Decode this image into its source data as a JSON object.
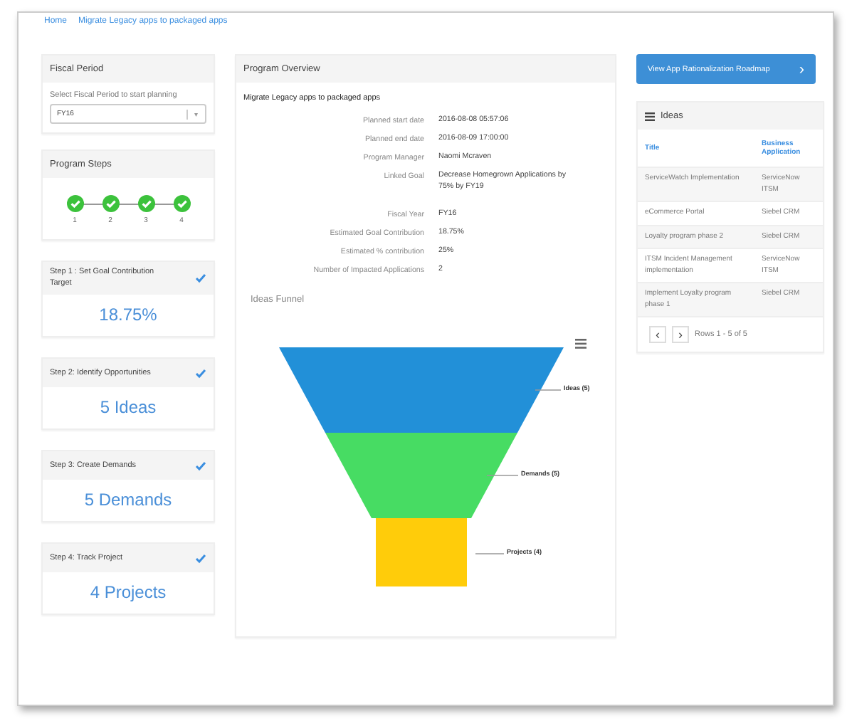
{
  "breadcrumb": [
    "Home",
    "Migrate Legacy apps to packaged apps"
  ],
  "fiscal_period": {
    "title": "Fiscal Period",
    "hint": "Select Fiscal Period to start planning",
    "value": "FY16",
    "caret": "▾"
  },
  "program_steps": {
    "title": "Program Steps",
    "steps": [
      {
        "label": "1",
        "completed": true
      },
      {
        "label": "2",
        "completed": true
      },
      {
        "label": "3",
        "completed": true
      },
      {
        "label": "4",
        "completed": true
      }
    ]
  },
  "step_cards": [
    {
      "title": "Step 1 : Set Goal Contribution Target",
      "value": "18.75%",
      "completed": true
    },
    {
      "title": "Step 2: Identify Opportunities",
      "value": "5 Ideas",
      "completed": true
    },
    {
      "title": "Step 3: Create Demands",
      "value": "5 Demands",
      "completed": true
    },
    {
      "title": "Step 4: Track Project",
      "value": "4 Projects",
      "completed": true
    }
  ],
  "overview": {
    "title": "Program Overview",
    "program_name": "Migrate Legacy apps to packaged apps",
    "fields": [
      {
        "label": "Planned start date",
        "value": "2016-08-08 05:57:06"
      },
      {
        "label": "Planned end date",
        "value": "2016-08-09 17:00:00"
      },
      {
        "label": "Program Manager",
        "value": "Naomi Mcraven"
      },
      {
        "label": "Linked Goal",
        "value": "Decrease Homegrown Applications by 75% by FY19"
      },
      {
        "label": "Fiscal Year",
        "value": "FY16"
      },
      {
        "label": "Estimated Goal Contribution",
        "value": "18.75%"
      },
      {
        "label": "Estimated % contribution",
        "value": "25%"
      },
      {
        "label": "Number of Impacted Applications",
        "value": "2"
      }
    ]
  },
  "funnel": {
    "title": "Ideas Funnel",
    "stages": [
      {
        "label": "Ideas (5)",
        "color": "#2290d8"
      },
      {
        "label": "Demands (5)",
        "color": "#47dc63"
      },
      {
        "label": "Projects (4)",
        "color": "#ffcc0a"
      }
    ]
  },
  "roadmap_button": {
    "label": "View App Rationalization Roadmap",
    "arrow": "›"
  },
  "ideas": {
    "title": "Ideas",
    "columns": [
      "Title",
      "Business Application"
    ],
    "rows": [
      [
        "ServiceWatch Implementation",
        "ServiceNow ITSM"
      ],
      [
        "eCommerce Portal",
        "Siebel CRM"
      ],
      [
        "Loyalty program phase 2",
        "Siebel CRM"
      ],
      [
        "ITSM Incident Management implementation",
        "ServiceNow ITSM"
      ],
      [
        "Implement Loyalty program phase 1",
        "Siebel CRM"
      ]
    ],
    "prev": "‹",
    "next": "›",
    "rows_info": "Rows 1 - 5 of 5"
  }
}
